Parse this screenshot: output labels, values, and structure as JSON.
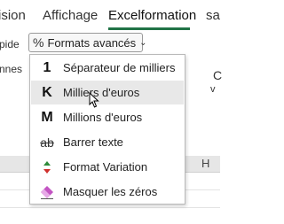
{
  "tabs": [
    {
      "label": "ision"
    },
    {
      "label": "Affichage"
    },
    {
      "label": "Excelformation"
    },
    {
      "label": "sa"
    }
  ],
  "ribbon": {
    "left_top": "pide",
    "left_mid": "nnes",
    "formats_button": {
      "icon": "%",
      "label": "Formats avancés"
    },
    "right_fragment_1": "C",
    "right_fragment_2": "v"
  },
  "sheet": {
    "column_header": "H"
  },
  "menu": {
    "items": [
      {
        "icon": "1",
        "label": "Séparateur de milliers"
      },
      {
        "icon": "K",
        "label": "Milliers d'euros"
      },
      {
        "icon": "M",
        "label": "Millions d'euros"
      },
      {
        "icon": "ab",
        "label": "Barrer texte"
      },
      {
        "icon": "variation-arrows-icon",
        "label": "Format Variation"
      },
      {
        "icon": "eraser-icon",
        "label": "Masquer les zéros"
      }
    ]
  },
  "colors": {
    "accent": "#217346",
    "hover": "#e8e8e8",
    "eraser": "#c355c3",
    "up_arrow": "#2e8b3a",
    "down_arrow": "#d0312d"
  }
}
